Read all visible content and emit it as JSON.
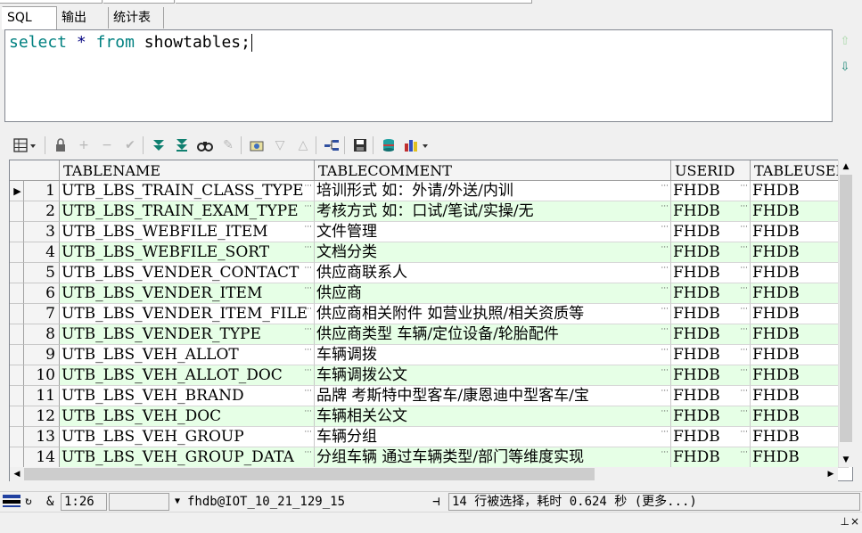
{
  "tabs": [
    {
      "label": "SQL",
      "active": true
    },
    {
      "label": "输出",
      "active": false
    },
    {
      "label": "统计表",
      "active": false
    }
  ],
  "editor": {
    "keyword_select": "select",
    "operator_star": "*",
    "keyword_from": "from",
    "table_semicolon": "showtables;"
  },
  "toolbar": {
    "icons": [
      "grid-menu-icon",
      "lock-icon",
      "add-record-icon",
      "delete-record-icon",
      "post-changes-icon",
      "next-page-icon",
      "last-page-icon",
      "find-icon",
      "clear-icon",
      "query-by-example-icon",
      "filter-icon",
      "sort-icon",
      "explain-plan-icon",
      "save-icon",
      "export-icon",
      "chart-icon"
    ]
  },
  "grid": {
    "columns": [
      "TABLENAME",
      "TABLECOMMENT",
      "USERID",
      "TABLEUSER"
    ],
    "rows": [
      {
        "n": "1",
        "name": "UTB_LBS_TRAIN_CLASS_TYPE",
        "comment": "培训形式 如：外请/外送/内训",
        "userid": "FHDB",
        "tableuser": "FHDB"
      },
      {
        "n": "2",
        "name": "UTB_LBS_TRAIN_EXAM_TYPE",
        "comment": "考核方式 如：口试/笔试/实操/无",
        "userid": "FHDB",
        "tableuser": "FHDB"
      },
      {
        "n": "3",
        "name": "UTB_LBS_WEBFILE_ITEM",
        "comment": "文件管理",
        "userid": "FHDB",
        "tableuser": "FHDB"
      },
      {
        "n": "4",
        "name": "UTB_LBS_WEBFILE_SORT",
        "comment": "文档分类",
        "userid": "FHDB",
        "tableuser": "FHDB"
      },
      {
        "n": "5",
        "name": "UTB_LBS_VENDER_CONTACT",
        "comment": "供应商联系人",
        "userid": "FHDB",
        "tableuser": "FHDB"
      },
      {
        "n": "6",
        "name": "UTB_LBS_VENDER_ITEM",
        "comment": "供应商",
        "userid": "FHDB",
        "tableuser": "FHDB"
      },
      {
        "n": "7",
        "name": "UTB_LBS_VENDER_ITEM_FILE",
        "comment": "供应商相关附件 如营业执照/相关资质等",
        "userid": "FHDB",
        "tableuser": "FHDB"
      },
      {
        "n": "8",
        "name": "UTB_LBS_VENDER_TYPE",
        "comment": "供应商类型 车辆/定位设备/轮胎配件",
        "userid": "FHDB",
        "tableuser": "FHDB"
      },
      {
        "n": "9",
        "name": "UTB_LBS_VEH_ALLOT",
        "comment": "车辆调拨",
        "userid": "FHDB",
        "tableuser": "FHDB"
      },
      {
        "n": "10",
        "name": "UTB_LBS_VEH_ALLOT_DOC",
        "comment": "车辆调拨公文",
        "userid": "FHDB",
        "tableuser": "FHDB"
      },
      {
        "n": "11",
        "name": "UTB_LBS_VEH_BRAND",
        "comment": "品牌 考斯特中型客车/康恩迪中型客车/宝",
        "userid": "FHDB",
        "tableuser": "FHDB"
      },
      {
        "n": "12",
        "name": "UTB_LBS_VEH_DOC",
        "comment": "车辆相关公文",
        "userid": "FHDB",
        "tableuser": "FHDB"
      },
      {
        "n": "13",
        "name": "UTB_LBS_VEH_GROUP",
        "comment": "车辆分组",
        "userid": "FHDB",
        "tableuser": "FHDB"
      },
      {
        "n": "14",
        "name": "UTB_LBS_VEH_GROUP_DATA",
        "comment": "分组车辆 通过车辆类型/部门等维度实现",
        "userid": "FHDB",
        "tableuser": "FHDB"
      }
    ]
  },
  "status": {
    "amp": "&",
    "position": "1:26",
    "connection": "fhdb@IOT_10_21_129_15",
    "message": "14 行被选择，耗时 0.624 秒 (更多...)"
  },
  "colors": {
    "keyword": "#008080",
    "alt_row": "#e6ffe6",
    "grid_border": "#828790"
  }
}
